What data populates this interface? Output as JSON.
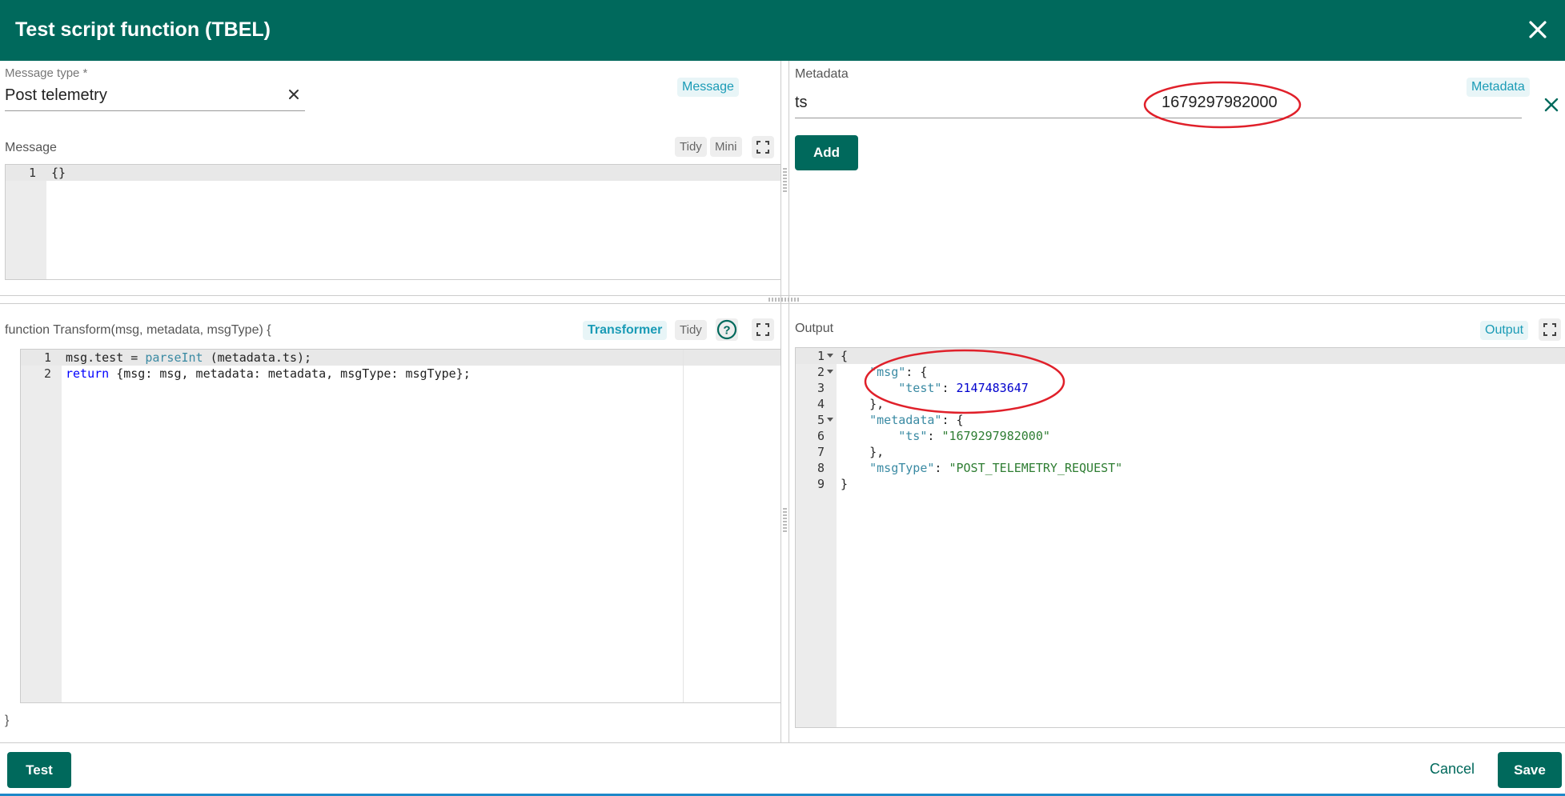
{
  "dialog": {
    "title": "Test script function (TBEL)"
  },
  "message_type": {
    "label": "Message type *",
    "value": "Post telemetry",
    "chip": "Message"
  },
  "message": {
    "label": "Message",
    "tidy": "Tidy",
    "mini": "Mini",
    "line_numbers": [
      "1"
    ],
    "code": [
      "{}"
    ]
  },
  "metadata": {
    "label": "Metadata",
    "chip": "Metadata",
    "key": "ts",
    "value": "1679297982000",
    "add_label": "Add"
  },
  "function": {
    "signature": "function Transform(msg, metadata, msgType) {",
    "chip": "Transformer",
    "tidy": "Tidy",
    "help": "?",
    "closing": "}",
    "line_numbers": [
      "1",
      "2"
    ],
    "line1": {
      "a": "msg.test = ",
      "b": "parseInt",
      "c": " (metadata.ts);"
    },
    "line2": {
      "a": "return",
      "b": " {msg: msg, metadata: metadata, msgType: msgType};"
    }
  },
  "output": {
    "label": "Output",
    "chip": "Output",
    "line_numbers": [
      "1",
      "2",
      "3",
      "4",
      "5",
      "6",
      "7",
      "8",
      "9"
    ],
    "l1": "{",
    "l2_key": "\"msg\"",
    "l2_rest": ": {",
    "l3_key": "\"test\"",
    "l3_sep": ": ",
    "l3_val": "2147483647",
    "l4": "},",
    "l5_key": "\"metadata\"",
    "l5_rest": ": {",
    "l6_key": "\"ts\"",
    "l6_sep": ": ",
    "l6_val": "\"1679297982000\"",
    "l7": "},",
    "l8_key": "\"msgType\"",
    "l8_sep": ": ",
    "l8_val": "\"POST_TELEMETRY_REQUEST\"",
    "l9": "}"
  },
  "footer": {
    "test_label": "Test",
    "cancel_label": "Cancel",
    "save_label": "Save"
  },
  "colors": {
    "header": "#00695c",
    "accent_chip": "#1a9bb6",
    "annotation": "#e0202a"
  }
}
